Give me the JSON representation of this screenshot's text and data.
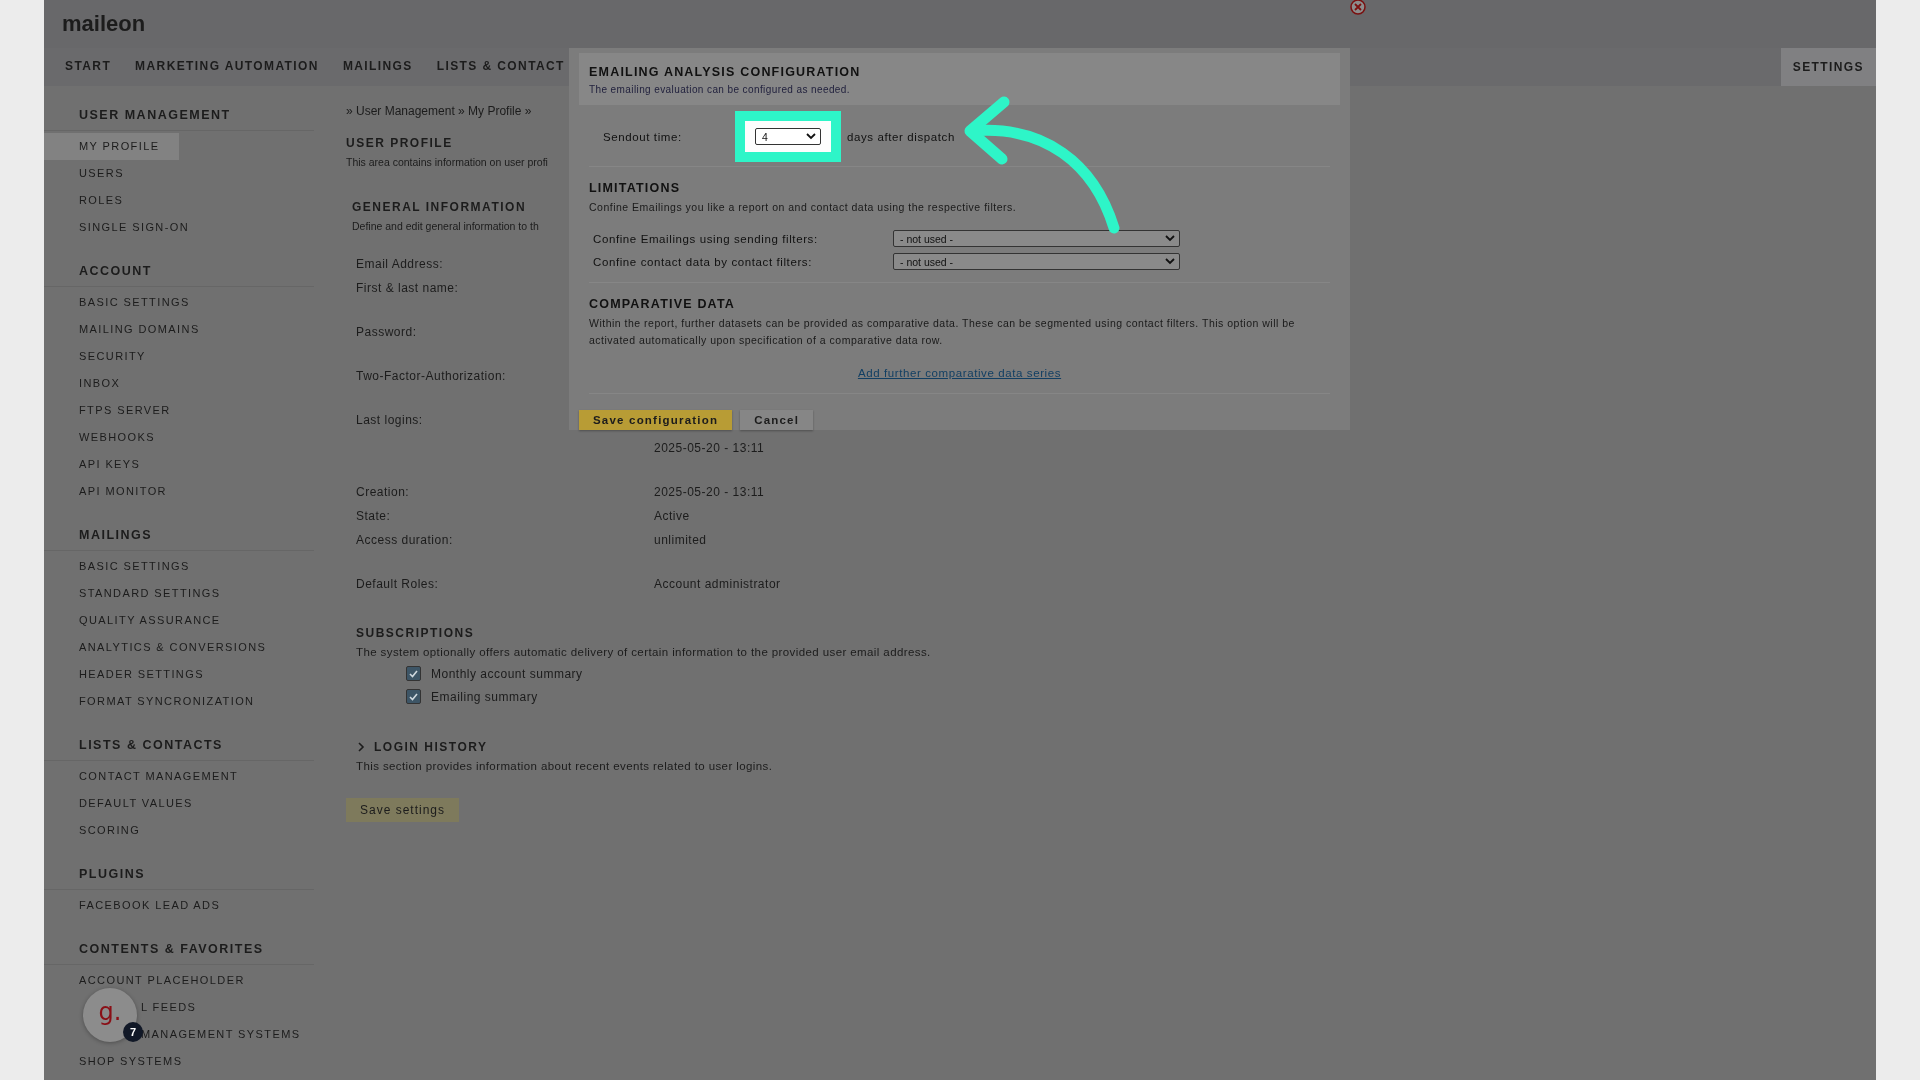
{
  "header": {
    "logo": "maileon"
  },
  "nav": {
    "items": [
      {
        "label": "START",
        "selected": false
      },
      {
        "label": "MARKETING AUTOMATION",
        "selected": false
      },
      {
        "label": "MAILINGS",
        "selected": false
      },
      {
        "label": "LISTS & CONTACT",
        "selected": false
      }
    ],
    "settings": {
      "label": "SETTINGS",
      "selected": true
    }
  },
  "sidebar": {
    "sections": [
      {
        "title": "USER MANAGEMENT",
        "items": [
          {
            "label": "MY PROFILE",
            "selected": true
          },
          {
            "label": "USERS",
            "selected": false
          },
          {
            "label": "ROLES",
            "selected": false
          },
          {
            "label": "SINGLE SIGN-ON",
            "selected": false
          }
        ]
      },
      {
        "title": "ACCOUNT",
        "items": [
          {
            "label": "BASIC SETTINGS",
            "selected": false
          },
          {
            "label": "MAILING DOMAINS",
            "selected": false
          },
          {
            "label": "SECURITY",
            "selected": false
          },
          {
            "label": "INBOX",
            "selected": false
          },
          {
            "label": "FTPS SERVER",
            "selected": false
          },
          {
            "label": "WEBHOOKS",
            "selected": false
          },
          {
            "label": "API KEYS",
            "selected": false
          },
          {
            "label": "API MONITOR",
            "selected": false
          }
        ]
      },
      {
        "title": "MAILINGS",
        "items": [
          {
            "label": "BASIC SETTINGS",
            "selected": false
          },
          {
            "label": "STANDARD SETTINGS",
            "selected": false
          },
          {
            "label": "QUALITY ASSURANCE",
            "selected": false
          },
          {
            "label": "ANALYTICS & CONVERSIONS",
            "selected": false
          },
          {
            "label": "HEADER SETTINGS",
            "selected": false
          },
          {
            "label": "FORMAT SYNCRONIZATION",
            "selected": false
          }
        ]
      },
      {
        "title": "LISTS & CONTACTS",
        "items": [
          {
            "label": "CONTACT MANAGEMENT",
            "selected": false
          },
          {
            "label": "DEFAULT VALUES",
            "selected": false
          },
          {
            "label": "SCORING",
            "selected": false
          }
        ]
      },
      {
        "title": "PLUGINS",
        "items": [
          {
            "label": "FACEBOOK LEAD ADS",
            "selected": false
          }
        ]
      },
      {
        "title": "CONTENTS & FAVORITES",
        "items": [
          {
            "label": "ACCOUNT PLACEHOLDER",
            "selected": false
          },
          {
            "label": "L FEEDS",
            "selected": false,
            "covered": true
          },
          {
            "label": "MANAGEMENT SYSTEMS",
            "selected": false,
            "covered": true
          },
          {
            "label": "SHOP SYSTEMS",
            "selected": false
          }
        ]
      }
    ]
  },
  "main": {
    "breadcrumb": "» User Management » My Profile »",
    "title": "USER PROFILE",
    "intro": "This area contains information on user profi",
    "general": {
      "title": "GENERAL INFORMATION",
      "description": "Define and edit general information to th"
    },
    "fields": [
      {
        "label": "Email Address:"
      },
      {
        "label": "First & last name:"
      },
      {
        "label": "Password:"
      },
      {
        "label": "Two-Factor-Authorization:"
      },
      {
        "label": "Last logins:"
      },
      {
        "value": "2025-05-20 - 13:11"
      },
      {
        "label": "Creation:",
        "value": "2025-05-20 - 13:11"
      },
      {
        "label": "State:",
        "value": "Active"
      },
      {
        "label": "Access duration:",
        "value": "unlimited"
      },
      {
        "label": "Default Roles:",
        "value": "Account administrator"
      }
    ],
    "subscriptions": {
      "title": "SUBSCRIPTIONS",
      "description": "The system optionally offers automatic delivery of certain information to the provided user email address.",
      "options": [
        {
          "label": "Monthly account summary",
          "checked": true
        },
        {
          "label": "Emailing summary",
          "checked": true
        }
      ]
    },
    "login_history": {
      "title": "LOGIN HISTORY",
      "description": "This section provides information about recent events related to user logins.",
      "expanded": false
    },
    "save_button": "Save settings"
  },
  "dialog": {
    "title": "EMAILING ANALYSIS CONFIGURATION",
    "subtitle": "The emailing evaluation can be configured as needed.",
    "sendout": {
      "label": "Sendout time:",
      "value": "4",
      "suffix": "days after dispatch"
    },
    "limitations": {
      "title": "LIMITATIONS",
      "description": "Confine Emailings you like a report on and contact data using the respective filters.",
      "filters": [
        {
          "label": "Confine Emailings using sending filters:",
          "value": "- not used -"
        },
        {
          "label": "Confine contact data by contact filters:",
          "value": "- not used -"
        }
      ]
    },
    "comparative": {
      "title": "COMPARATIVE DATA",
      "description": "Within the report, further datasets can be provided as comparative data. These can be segmented using contact filters. This option will be activated automatically upon specification of a comparative data row.",
      "link": "Add further comparative data series"
    },
    "buttons": [
      {
        "label": "Save configuration",
        "kind": "primary"
      },
      {
        "label": "Cancel",
        "kind": "secondary"
      }
    ]
  },
  "launcher": {
    "logo": "g.",
    "badge": "7"
  }
}
